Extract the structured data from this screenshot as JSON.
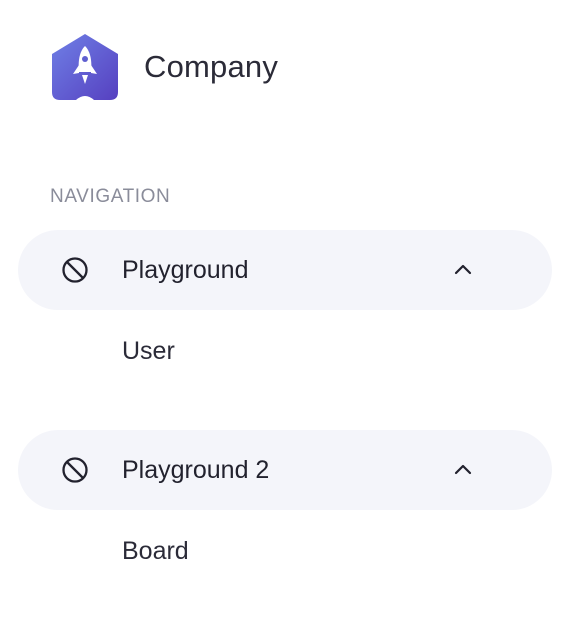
{
  "brand": {
    "name": "Company",
    "logo_icon": "rocket-icon",
    "logo_gradient": [
      "#6a7ae0",
      "#5a45c2"
    ]
  },
  "navigation": {
    "section_label": "NAVIGATION",
    "groups": [
      {
        "label": "Playground",
        "icon": "prohibited-icon",
        "expanded": true,
        "toggle_icon": "chevron-up-icon",
        "items": [
          {
            "label": "User"
          }
        ]
      },
      {
        "label": "Playground 2",
        "icon": "prohibited-icon",
        "expanded": true,
        "toggle_icon": "chevron-up-icon",
        "items": [
          {
            "label": "Board"
          }
        ]
      }
    ]
  },
  "colors": {
    "group_background": "#f4f5fa",
    "section_label": "#8a8c9a",
    "text": "#22222e"
  }
}
